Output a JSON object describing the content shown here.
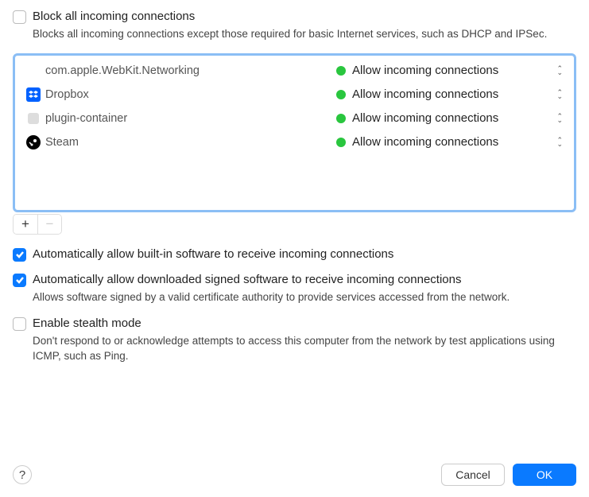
{
  "block_all": {
    "checked": false,
    "label": "Block all incoming connections",
    "desc": "Blocks all incoming connections except those required for basic Internet services, such as DHCP and IPSec."
  },
  "apps": [
    {
      "name": "com.apple.WebKit.Networking",
      "icon": "none",
      "status": "Allow incoming connections"
    },
    {
      "name": "Dropbox",
      "icon": "dropbox",
      "status": "Allow incoming connections"
    },
    {
      "name": "plugin-container",
      "icon": "plugin",
      "status": "Allow incoming connections"
    },
    {
      "name": "Steam",
      "icon": "steam",
      "status": "Allow incoming connections"
    }
  ],
  "auto_builtin": {
    "checked": true,
    "label": "Automatically allow built-in software to receive incoming connections"
  },
  "auto_signed": {
    "checked": true,
    "label": "Automatically allow downloaded signed software to receive incoming connections",
    "desc": "Allows software signed by a valid certificate authority to provide services accessed from the network."
  },
  "stealth": {
    "checked": false,
    "label": "Enable stealth mode",
    "desc": "Don't respond to or acknowledge attempts to access this computer from the network by test applications using ICMP, such as Ping."
  },
  "buttons": {
    "cancel": "Cancel",
    "ok": "OK",
    "help": "?"
  }
}
